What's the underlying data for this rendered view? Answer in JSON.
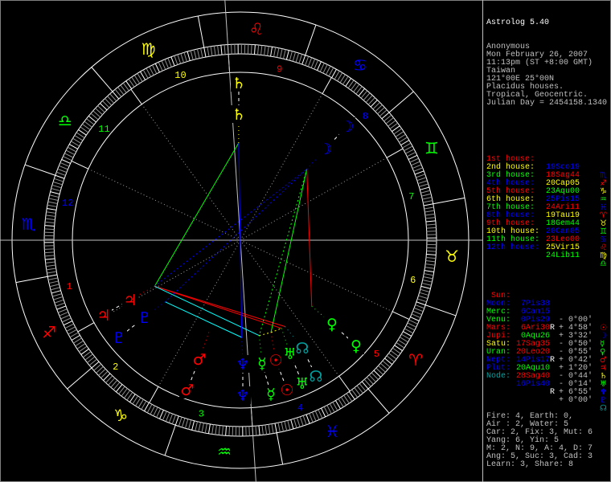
{
  "header": {
    "title": "Astrolog 5.40",
    "lines": [
      "Anonymous",
      "Mon February 26, 2007",
      "11:13pm (ST +8:00 GMT)",
      "Taiwan",
      "121°00E 25°00N",
      "Placidus houses.",
      "Tropical, Geocentric.",
      "Julian Day = 2454158.1340"
    ]
  },
  "colors": {
    "red": "#ff0000",
    "yellow": "#ffff00",
    "green": "#00ff00",
    "blue": "#0000ff",
    "cyan": "#00ffff",
    "teal": "#00a0a0",
    "gray": "#a0a0a0",
    "white": "#ffffff"
  },
  "houses": [
    {
      "label": "1st house:",
      "position": "19Sco19",
      "glyph": "♏",
      "label_color": "#ff0000",
      "pos_color": "#0000ff",
      "lon": 229.32
    },
    {
      "label": "2nd house:",
      "position": "18Sag44",
      "glyph": "♐",
      "label_color": "#ffff00",
      "pos_color": "#ff0000",
      "lon": 258.73
    },
    {
      "label": "3rd house:",
      "position": "20Cap05",
      "glyph": "♑",
      "label_color": "#00ff00",
      "pos_color": "#ffff00",
      "lon": 290.08
    },
    {
      "label": "4th house:",
      "position": "23Aqu00",
      "glyph": "♒",
      "label_color": "#0000ff",
      "pos_color": "#00ff00",
      "lon": 323.0
    },
    {
      "label": "5th house:",
      "position": "25Pis15",
      "glyph": "♓",
      "label_color": "#ff0000",
      "pos_color": "#0000ff",
      "lon": 355.25
    },
    {
      "label": "6th house:",
      "position": "24Ari11",
      "glyph": "♈",
      "label_color": "#ffff00",
      "pos_color": "#ff0000",
      "lon": 24.18
    },
    {
      "label": "7th house:",
      "position": "19Tau19",
      "glyph": "♉",
      "label_color": "#00ff00",
      "pos_color": "#ffff00",
      "lon": 49.32
    },
    {
      "label": "8th house:",
      "position": "18Gem44",
      "glyph": "♊",
      "label_color": "#0000ff",
      "pos_color": "#00ff00",
      "lon": 78.73
    },
    {
      "label": "9th house:",
      "position": "20Can05",
      "glyph": "♋",
      "label_color": "#ff0000",
      "pos_color": "#0000ff",
      "lon": 110.08
    },
    {
      "label": "10th house:",
      "position": "23Leo00",
      "glyph": "♌",
      "label_color": "#ffff00",
      "pos_color": "#ff0000",
      "lon": 143.0
    },
    {
      "label": "11th house:",
      "position": "25Vir15",
      "glyph": "♍",
      "label_color": "#00ff00",
      "pos_color": "#ffff00",
      "lon": 175.25
    },
    {
      "label": "12th house:",
      "position": "24Lib11",
      "glyph": "♎",
      "label_color": "#0000ff",
      "pos_color": "#00ff00",
      "lon": 204.18
    }
  ],
  "house_numbers": [
    "1",
    "2",
    "3",
    "4",
    "5",
    "6",
    "7",
    "8",
    "9",
    "10",
    "11",
    "12"
  ],
  "signs": [
    {
      "glyph": "♈",
      "color": "#ff0000"
    },
    {
      "glyph": "♉",
      "color": "#ffff00"
    },
    {
      "glyph": "♊",
      "color": "#00ff00"
    },
    {
      "glyph": "♋",
      "color": "#0000ff"
    },
    {
      "glyph": "♌",
      "color": "#ff0000"
    },
    {
      "glyph": "♍",
      "color": "#ffff00"
    },
    {
      "glyph": "♎",
      "color": "#00ff00"
    },
    {
      "glyph": "♏",
      "color": "#0000ff"
    },
    {
      "glyph": "♐",
      "color": "#ff0000"
    },
    {
      "glyph": "♑",
      "color": "#ffff00"
    },
    {
      "glyph": "♒",
      "color": "#00ff00"
    },
    {
      "glyph": "♓",
      "color": "#0000ff"
    }
  ],
  "planets": [
    {
      "name": "Sun:",
      "position": "7Pis38",
      "retro": "",
      "offset": "- 0°00'",
      "glyph": "☉",
      "name_color": "#ff0000",
      "pos_color": "#0000ff",
      "glyph_color": "#ff0000",
      "lon": 337.63
    },
    {
      "name": "Moon:",
      "position": "6Can15",
      "retro": "",
      "offset": "+ 4°58'",
      "glyph": "☽",
      "name_color": "#0000ff",
      "pos_color": "#0000ff",
      "glyph_color": "#0000ff",
      "lon": 96.25
    },
    {
      "name": "Merc:",
      "position": "0Pis29",
      "retro": "R",
      "offset": "+ 3°32'",
      "glyph": "☿",
      "name_color": "#00ff00",
      "pos_color": "#0000ff",
      "glyph_color": "#00ff00",
      "lon": 330.48
    },
    {
      "name": "Venu:",
      "position": "6Ari30",
      "retro": "",
      "offset": "- 0°50'",
      "glyph": "♀",
      "name_color": "#00ff00",
      "pos_color": "#ff0000",
      "glyph_color": "#00ff00",
      "lon": 6.5
    },
    {
      "name": "Mars:",
      "position": "0Aqu26",
      "retro": "",
      "offset": "- 0°55'",
      "glyph": "♂",
      "name_color": "#ff0000",
      "pos_color": "#00ff00",
      "glyph_color": "#ff0000",
      "lon": 300.43
    },
    {
      "name": "Jupi:",
      "position": "17Sag35",
      "retro": "",
      "offset": "+ 0°42'",
      "glyph": "♃",
      "name_color": "#ff0000",
      "pos_color": "#ff0000",
      "glyph_color": "#ff0000",
      "lon": 257.58
    },
    {
      "name": "Satu:",
      "position": "20Leo20",
      "retro": "R",
      "offset": "+ 1°20'",
      "glyph": "♄",
      "name_color": "#ffff00",
      "pos_color": "#ff0000",
      "glyph_color": "#ffff00",
      "lon": 140.33
    },
    {
      "name": "Uran:",
      "position": "14Pis17",
      "retro": "",
      "offset": "- 0°44'",
      "glyph": "♅",
      "name_color": "#00ff00",
      "pos_color": "#0000ff",
      "glyph_color": "#00ff00",
      "lon": 344.28
    },
    {
      "name": "Nept:",
      "position": "20Aqu10",
      "retro": "",
      "offset": "- 0°14'",
      "glyph": "♆",
      "name_color": "#0000ff",
      "pos_color": "#00ff00",
      "glyph_color": "#0000ff",
      "lon": 320.17
    },
    {
      "name": "Plut:",
      "position": "28Sag40",
      "retro": "",
      "offset": "+ 6°55'",
      "glyph": "♇",
      "name_color": "#0000ff",
      "pos_color": "#ff0000",
      "glyph_color": "#0000ff",
      "lon": 268.67
    },
    {
      "name": "Node:",
      "position": "16Pis40",
      "retro": "R",
      "offset": "+ 0°00'",
      "glyph": "☊",
      "name_color": "#00a0a0",
      "pos_color": "#0000ff",
      "glyph_color": "#00a0a0",
      "lon": 346.67
    }
  ],
  "summary": [
    "Fire: 4, Earth: 0,",
    "Air : 2, Water: 5",
    "Car: 2, Fix: 3, Mut: 6",
    "Yang: 6, Yin: 5",
    "M: 2, N: 9, A: 4, D: 7",
    "Ang: 5, Suc: 3, Cad: 3",
    "Learn: 3, Share: 8"
  ],
  "aspects": [
    {
      "from": 5,
      "to": 6,
      "color": "#00ff00",
      "style": "solid"
    },
    {
      "from": 5,
      "to": 1,
      "color": "#0000ff",
      "style": "dotted"
    },
    {
      "from": 5,
      "to": 7,
      "color": "#ff0000",
      "style": "solid"
    },
    {
      "from": 5,
      "to": 10,
      "color": "#ff0000",
      "style": "solid"
    },
    {
      "from": 5,
      "to": 2,
      "color": "#00ffff",
      "style": "solid"
    },
    {
      "from": 9,
      "to": 8,
      "color": "#00ffff",
      "style": "solid"
    },
    {
      "from": 6,
      "to": 8,
      "color": "#0000ff",
      "style": "solid"
    },
    {
      "from": 1,
      "to": 9,
      "color": "#0000ff",
      "style": "dotted"
    },
    {
      "from": 1,
      "to": 0,
      "color": "#00ff00",
      "style": "solid"
    },
    {
      "from": 1,
      "to": 2,
      "color": "#00ff00",
      "style": "dotted"
    },
    {
      "from": 1,
      "to": 3,
      "color": "#ff0000",
      "style": "solid"
    },
    {
      "from": 2,
      "to": 0,
      "color": "#ffff00",
      "style": "dotted"
    },
    {
      "from": 0,
      "to": 7,
      "color": "#ffff00",
      "style": "dotted"
    }
  ]
}
